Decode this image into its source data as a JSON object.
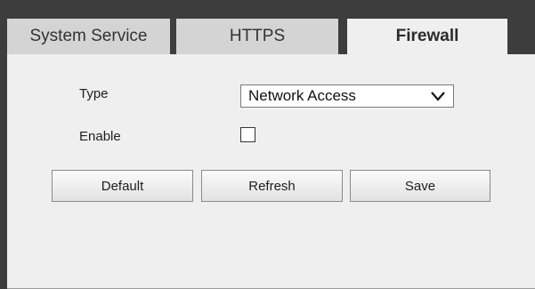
{
  "tabs": {
    "system_service": "System Service",
    "https": "HTTPS",
    "firewall": "Firewall",
    "active": "Firewall"
  },
  "form": {
    "type_label": "Type",
    "type_value": "Network Access",
    "enable_label": "Enable",
    "enable_checked": false
  },
  "buttons": {
    "default_label": "Default",
    "refresh_label": "Refresh",
    "save_label": "Save"
  },
  "icons": {
    "select_arrow": "chevron-down-icon"
  }
}
